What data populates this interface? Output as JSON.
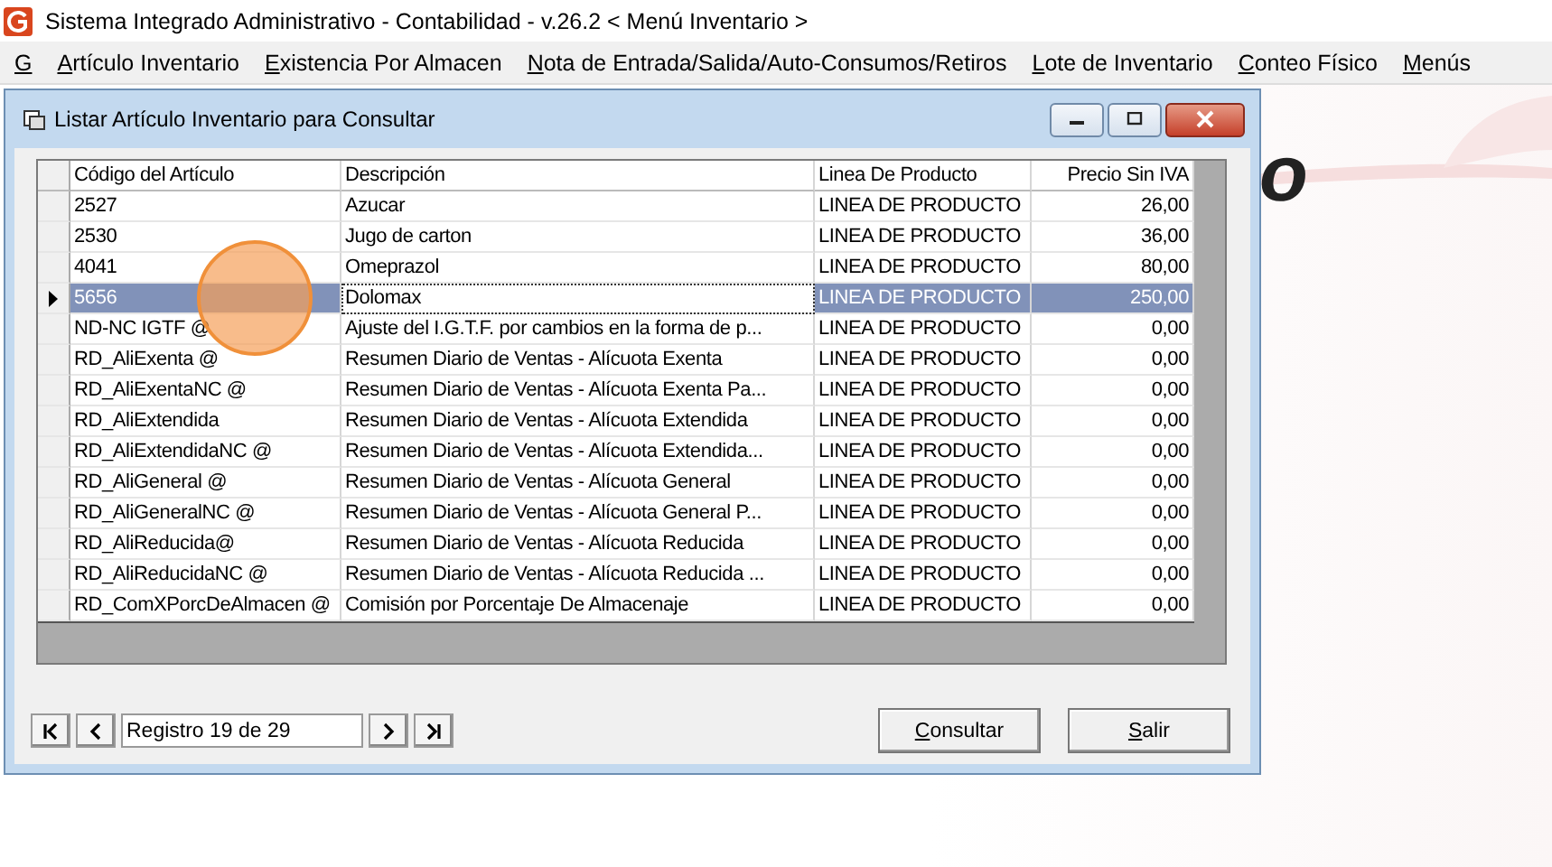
{
  "window": {
    "title": "Sistema Integrado Administrativo - Contabilidad - v.26.2 < Menú Inventario >"
  },
  "menu": [
    "G",
    "Artículo Inventario",
    "Existencia Por Almacen",
    "Nota de Entrada/Salida/Auto-Consumos/Retiros",
    "Lote de Inventario",
    "Conteo Físico",
    "Menús"
  ],
  "background_logo": {
    "text": "o"
  },
  "dialog": {
    "title": "Listar Artículo Inventario para Consultar",
    "columns": [
      {
        "label": "Código del Artículo",
        "kind": "text",
        "focused": false
      },
      {
        "label": "Descripción",
        "kind": "text",
        "focused": true
      },
      {
        "label": "Linea De Producto",
        "kind": "text",
        "focused": false
      },
      {
        "label": "Precio Sin IVA",
        "kind": "number",
        "focused": false
      }
    ],
    "rows": [
      {
        "cells": [
          "2527",
          "Azucar",
          "LINEA DE PRODUCTO",
          "26,00"
        ],
        "selected": false
      },
      {
        "cells": [
          "2530",
          "Jugo de carton",
          "LINEA DE PRODUCTO",
          "36,00"
        ],
        "selected": false
      },
      {
        "cells": [
          "4041",
          "Omeprazol",
          "LINEA DE PRODUCTO",
          "80,00"
        ],
        "selected": false
      },
      {
        "cells": [
          "5656",
          "Dolomax",
          "LINEA DE PRODUCTO",
          "250,00"
        ],
        "selected": true
      },
      {
        "cells": [
          "ND-NC IGTF @",
          "Ajuste del I.G.T.F. por cambios en la forma de p...",
          "LINEA DE PRODUCTO",
          "0,00"
        ],
        "selected": false
      },
      {
        "cells": [
          "RD_AliExenta  @",
          "Resumen Diario de Ventas - Alícuota Exenta",
          "LINEA DE PRODUCTO",
          "0,00"
        ],
        "selected": false
      },
      {
        "cells": [
          "RD_AliExentaNC @",
          "Resumen Diario de Ventas - Alícuota Exenta Pa...",
          "LINEA DE PRODUCTO",
          "0,00"
        ],
        "selected": false
      },
      {
        "cells": [
          "RD_AliExtendida",
          "Resumen Diario de Ventas - Alícuota Extendida",
          "LINEA DE PRODUCTO",
          "0,00"
        ],
        "selected": false
      },
      {
        "cells": [
          "RD_AliExtendidaNC @",
          "Resumen Diario de Ventas - Alícuota Extendida...",
          "LINEA DE PRODUCTO",
          "0,00"
        ],
        "selected": false
      },
      {
        "cells": [
          "RD_AliGeneral @",
          "Resumen Diario de Ventas - Alícuota General",
          "LINEA DE PRODUCTO",
          "0,00"
        ],
        "selected": false
      },
      {
        "cells": [
          "RD_AliGeneralNC @",
          "Resumen Diario de Ventas - Alícuota General P...",
          "LINEA DE PRODUCTO",
          "0,00"
        ],
        "selected": false
      },
      {
        "cells": [
          "RD_AliReducida@",
          "Resumen Diario de Ventas - Alícuota Reducida",
          "LINEA DE PRODUCTO",
          "0,00"
        ],
        "selected": false
      },
      {
        "cells": [
          "RD_AliReducidaNC @",
          "Resumen Diario de Ventas - Alícuota Reducida ...",
          "LINEA DE PRODUCTO",
          "0,00"
        ],
        "selected": false
      },
      {
        "cells": [
          "RD_ComXPorcDeAlmacen @",
          "Comisión por Porcentaje De Almacenaje",
          "LINEA DE PRODUCTO",
          "0,00"
        ],
        "selected": false
      }
    ],
    "record_field": {
      "value": "Registro 19 de 29"
    },
    "buttons": [
      "Consultar",
      "Salir"
    ]
  }
}
